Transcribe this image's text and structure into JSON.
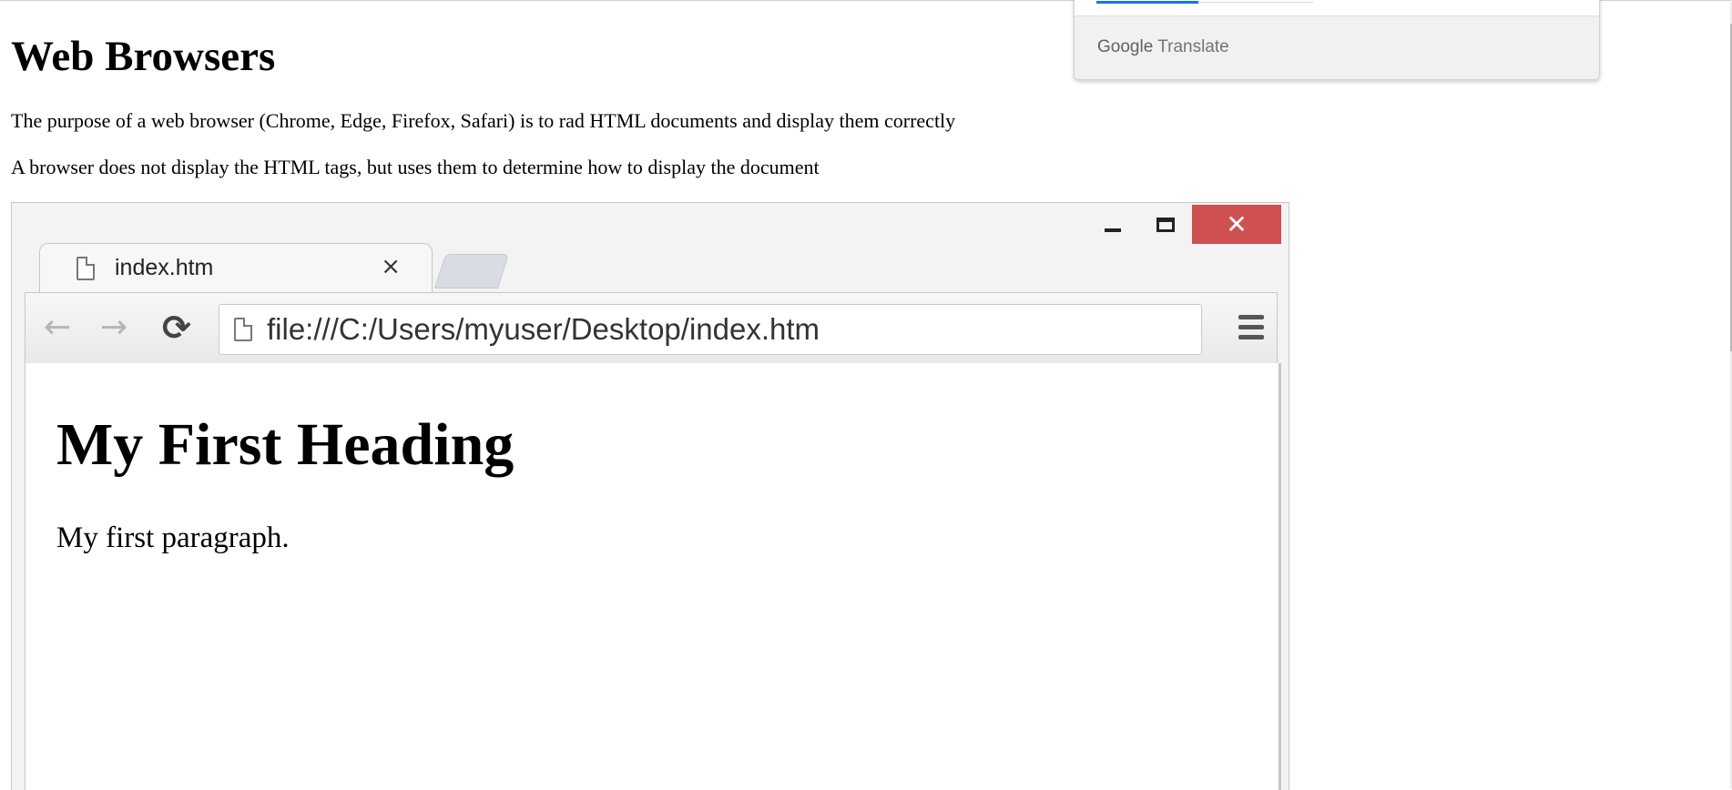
{
  "page": {
    "title": "Web Browsers",
    "paragraph1": "The purpose of a web browser (Chrome, Edge, Firefox, Safari) is to rad HTML documents and display them correctly",
    "paragraph2": "A browser does not display the HTML tags, but uses them to determine how to display the document"
  },
  "illustration": {
    "tab_label": "index.htm",
    "tab_close": "×",
    "url": "file:///C:/Users/myuser/Desktop/index.htm",
    "window_close": "✕",
    "nav": {
      "back": "←",
      "forward": "→",
      "reload": "⟳"
    },
    "content_heading": "My First Heading",
    "content_paragraph": "My first paragraph."
  },
  "translate_widget": {
    "brand_google": "Google",
    "brand_translate": "Translate"
  },
  "colors": {
    "close_button": "#cf5050",
    "translate_active_tab": "#1a73e8"
  },
  "icons": [
    "minimize-icon",
    "maximize-icon",
    "close-icon",
    "document-icon",
    "back-arrow-icon",
    "forward-arrow-icon",
    "reload-icon",
    "menu-icon"
  ]
}
